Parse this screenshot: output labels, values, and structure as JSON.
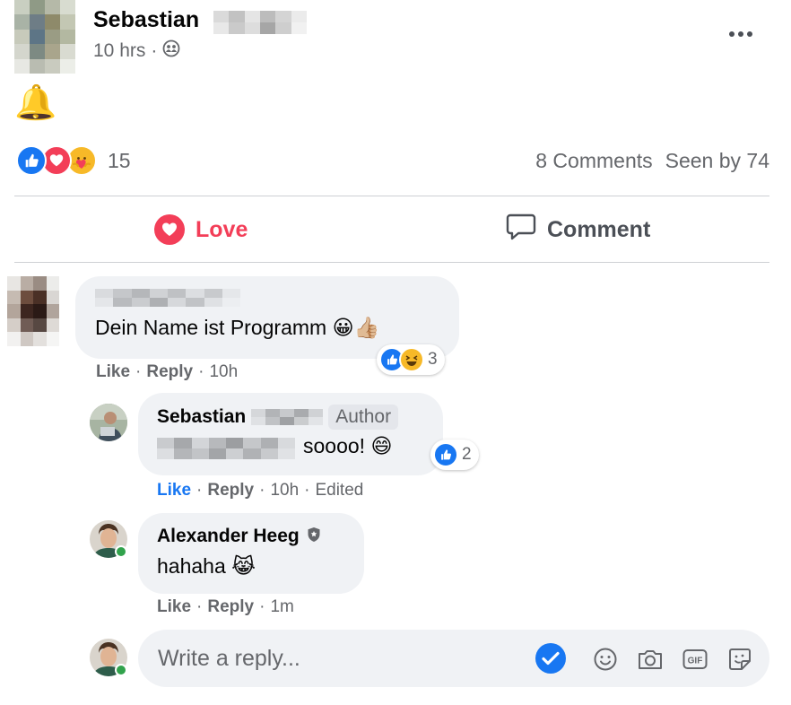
{
  "post": {
    "author_name": "Sebastian",
    "time": "10 hrs",
    "separator": "·",
    "post_emoji": "🔔",
    "reaction_count": "15",
    "comments_count": "8 Comments",
    "seen_by": "Seen by 74"
  },
  "actions": {
    "love_label": "Love",
    "comment_label": "Comment"
  },
  "comments": [
    {
      "text": "Dein Name ist Programm 😀👍🏼",
      "like": "Like",
      "reply": "Reply",
      "time": "10h",
      "reaction_count": "3"
    },
    {
      "name": "Sebastian",
      "badge": "Author",
      "text": "soooo! 😄",
      "like": "Like",
      "reply": "Reply",
      "time": "10h",
      "edited": "Edited",
      "reaction_count": "2"
    },
    {
      "name": "Alexander Heeg",
      "text": "hahaha 😹",
      "like": "Like",
      "reply": "Reply",
      "time": "1m"
    }
  ],
  "reply_box": {
    "placeholder": "Write a reply..."
  },
  "colors": {
    "like_blue": "#1877f2",
    "love_red": "#f33e58",
    "muted_text": "#65676b",
    "bubble_bg": "#f0f2f5",
    "online_green": "#31a24c"
  },
  "icons": {
    "reactions": [
      "like-icon",
      "love-icon",
      "care-icon"
    ],
    "input": [
      "check-icon",
      "emoji-icon",
      "camera-icon",
      "gif-icon",
      "sticker-icon"
    ]
  }
}
